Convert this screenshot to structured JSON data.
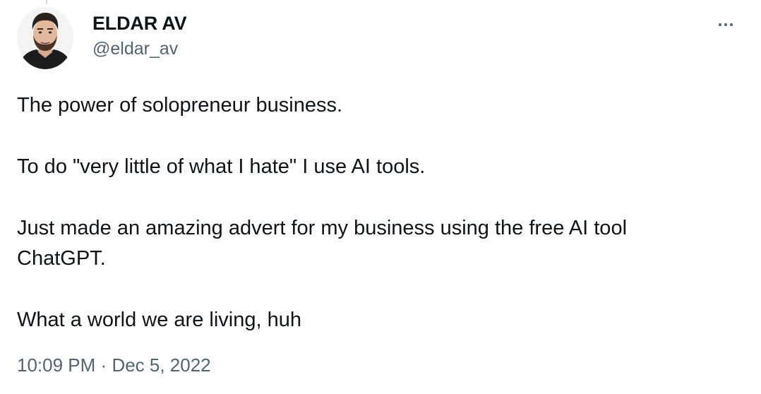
{
  "author": {
    "display_name": "ELDAR AV",
    "handle": "@eldar_av",
    "avatar_icon": "user-avatar-photo"
  },
  "menu": {
    "more_icon": "more-horizontal-icon"
  },
  "tweet": {
    "paragraphs": [
      "The power of solopreneur business.",
      "To do \"very little of what I hate\" I use AI tools.",
      "Just made an amazing advert for my business using the free AI tool\nChatGPT.",
      "What a world we are living, huh"
    ],
    "time": "10:09 PM",
    "separator": "·",
    "date": "Dec 5, 2022"
  },
  "colors": {
    "text_primary": "#0f1419",
    "text_secondary": "#536471",
    "background": "#ffffff"
  }
}
